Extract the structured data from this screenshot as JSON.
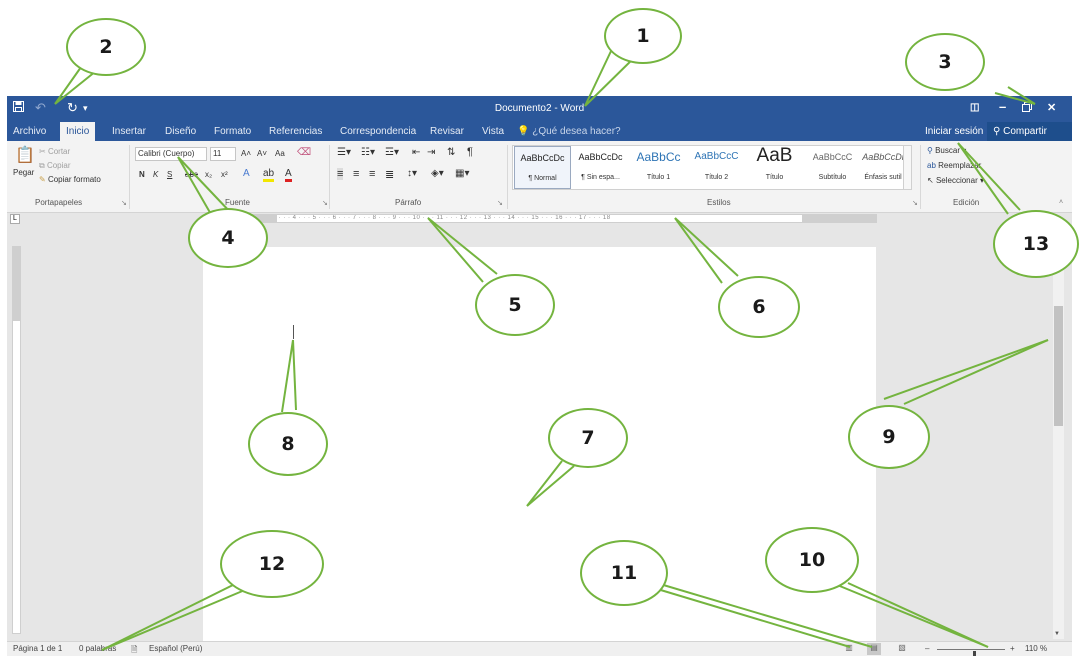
{
  "window": {
    "title": "Documento2 - Word",
    "quick_access": {
      "save_icon": "save-icon",
      "undo_icon": "undo-icon",
      "redo_icon": "redo-icon",
      "customize": "▾"
    },
    "controls": {
      "ribbon_options": "◫",
      "minimize": "–",
      "restore": "🗗",
      "close": "✕"
    }
  },
  "tabs": [
    {
      "label": "Archivo",
      "active": false
    },
    {
      "label": "Inicio",
      "active": true
    },
    {
      "label": "Insertar",
      "active": false
    },
    {
      "label": "Diseño",
      "active": false
    },
    {
      "label": "Formato",
      "active": false
    },
    {
      "label": "Referencias",
      "active": false
    },
    {
      "label": "Correspondencia",
      "active": false
    },
    {
      "label": "Revisar",
      "active": false
    },
    {
      "label": "Vista",
      "active": false
    }
  ],
  "tell_me": "¿Qué desea hacer?",
  "account": {
    "sign_in": "Iniciar sesión",
    "share": "Compartir"
  },
  "ribbon": {
    "clipboard": {
      "paste": "Pegar",
      "cut": "Cortar",
      "copy": "Copiar",
      "format_painter": "Copiar formato",
      "label": "Portapapeles"
    },
    "font": {
      "font_name": "Calibri (Cuerpo)",
      "font_size": "11",
      "grow": "A˄",
      "shrink": "A˅",
      "change_case": "Aa",
      "bold": "N",
      "italic": "K",
      "underline": "S",
      "strike": "abc",
      "subscript": "x₂",
      "superscript": "x²",
      "label": "Fuente"
    },
    "paragraph": {
      "label": "Párrafo"
    },
    "styles": {
      "label": "Estilos",
      "items": [
        {
          "sample": "AaBbCcDc",
          "name": "¶ Normal"
        },
        {
          "sample": "AaBbCcDc",
          "name": "¶ Sin espa..."
        },
        {
          "sample": "AaBbCc",
          "name": "Título 1"
        },
        {
          "sample": "AaBbCcC",
          "name": "Título 2"
        },
        {
          "sample": "AaB",
          "name": "Título"
        },
        {
          "sample": "AaBbCcC",
          "name": "Subtítulo"
        },
        {
          "sample": "AaBbCcDi",
          "name": "Énfasis sutil"
        }
      ]
    },
    "editing": {
      "find": "Buscar",
      "replace": "Reemplazar",
      "select": "Seleccionar",
      "label": "Edición"
    }
  },
  "ruler": {
    "text": "· 1 · · · 1 · · · 2 · · · 3 · · · 4 · · · 5 · · · 6 · · · 7 · · · 8 · · · 9 · · · 10 · · · 11 · · · 12 · · · 13 · · · 14 · · · 15 · · · 16 · · · 17 · · · 18"
  },
  "status": {
    "page": "Página 1 de 1",
    "words": "0 palabras",
    "language": "Español (Perú)",
    "zoom": "110 %",
    "zoom_level": 0.55
  },
  "callouts": [
    {
      "label": "1"
    },
    {
      "label": "2"
    },
    {
      "label": "3"
    },
    {
      "label": "4"
    },
    {
      "label": "5"
    },
    {
      "label": "6"
    },
    {
      "label": "7"
    },
    {
      "label": "8"
    },
    {
      "label": "9"
    },
    {
      "label": "10"
    },
    {
      "label": "11"
    },
    {
      "label": "12"
    },
    {
      "label": "13"
    }
  ]
}
